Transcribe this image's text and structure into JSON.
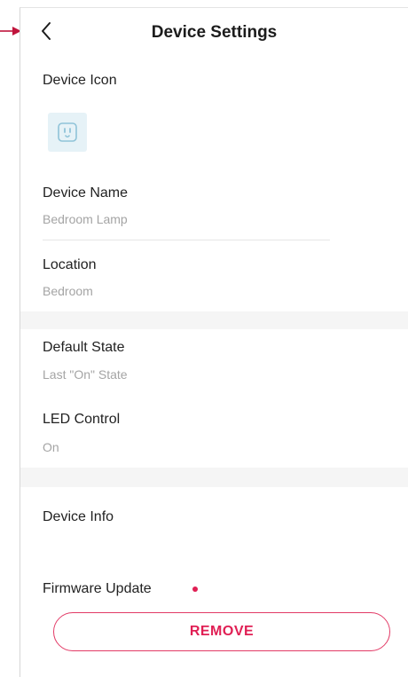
{
  "header": {
    "title": "Device Settings",
    "back_icon": "chevron-left-icon"
  },
  "device_icon": {
    "label": "Device Icon",
    "icon": "smart-plug-icon"
  },
  "device_name": {
    "label": "Device Name",
    "value": "Bedroom Lamp"
  },
  "location": {
    "label": "Location",
    "value": "Bedroom"
  },
  "default_state": {
    "label": "Default State",
    "value": "Last \"On\" State"
  },
  "led_control": {
    "label": "LED Control",
    "value": "On"
  },
  "device_info": {
    "label": "Device Info"
  },
  "firmware_update": {
    "label": "Firmware Update",
    "has_update_indicator": true
  },
  "remove_button": {
    "label": "REMOVE"
  },
  "colors": {
    "accent": "#e01f54",
    "text": "#222222",
    "secondary_text": "#a4a4a4",
    "band_background": "#f5f5f5",
    "icon_background": "#e6f2f7"
  }
}
